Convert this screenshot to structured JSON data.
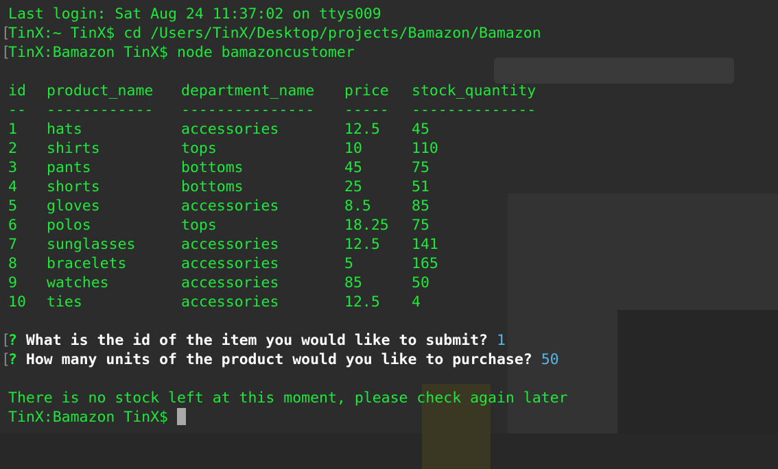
{
  "terminal": {
    "last_login": "Last login: Sat Aug 24 11:37:02 on ttys009",
    "cmd1": "TinX:~ TinX$ cd /Users/TinX/Desktop/projects/Bamazon/Bamazon",
    "cmd2": "TinX:Bamazon TinX$ node bamazoncustomer",
    "bracket_char": "[",
    "table": {
      "headers": [
        "id",
        "product_name",
        "department_name",
        "price",
        "stock_quantity"
      ],
      "dividers": [
        "--",
        "------------",
        "---------------",
        "-----",
        "--------------"
      ],
      "rows": [
        [
          "1",
          "hats",
          "accessories",
          "12.5",
          "45"
        ],
        [
          "2",
          "shirts",
          "tops",
          "10",
          "110"
        ],
        [
          "3",
          "pants",
          "bottoms",
          "45",
          "75"
        ],
        [
          "4",
          "shorts",
          "bottoms",
          "25",
          "51"
        ],
        [
          "5",
          "gloves",
          "accessories",
          "8.5",
          "85"
        ],
        [
          "6",
          "polos",
          "tops",
          "18.25",
          "75"
        ],
        [
          "7",
          "sunglasses",
          "accessories",
          "12.5",
          "141"
        ],
        [
          "8",
          "bracelets",
          "accessories",
          "5",
          "165"
        ],
        [
          "9",
          "watches",
          "accessories",
          "85",
          "50"
        ],
        [
          "10",
          "ties",
          "accessories",
          "12.5",
          "4"
        ]
      ]
    },
    "question1": {
      "mark": "?",
      "text": "What is the id of the item you would like to submit?",
      "answer": "1"
    },
    "question2": {
      "mark": "?",
      "text": "How many units of the product would you like to purchase?",
      "answer": "50"
    },
    "message": "There is no stock left at this moment, please check again later",
    "final_prompt": "TinX:Bamazon TinX$"
  },
  "colors": {
    "background": "#2c2c2c",
    "text_green": "#1ee93a",
    "prompt_white": "#ffffff",
    "answer_blue": "#55b6e6",
    "cursor_gray": "#a9a9a9"
  }
}
